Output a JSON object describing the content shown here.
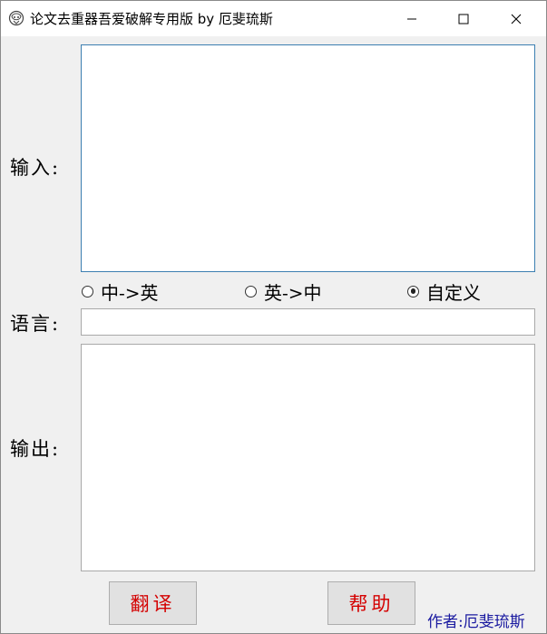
{
  "window": {
    "title": "论文去重器吾爱破解专用版 by 厄斐琉斯",
    "controls": {
      "minimize": "minimize",
      "maximize": "maximize",
      "close": "close"
    }
  },
  "form": {
    "input_label": "输入:",
    "language_label": "语言:",
    "output_label": "输出:",
    "input_text": "",
    "language_value": "",
    "output_text": ""
  },
  "radio_options": [
    {
      "label": "中->英",
      "checked": false
    },
    {
      "label": "英->中",
      "checked": false
    },
    {
      "label": "自定义",
      "checked": true
    }
  ],
  "buttons": {
    "translate": "翻译",
    "help": "帮助"
  },
  "footer": {
    "author": "作者:厄斐琉斯"
  },
  "icons": [
    "app-icon",
    "minimize-icon",
    "maximize-icon",
    "close-icon",
    "radio-icon"
  ]
}
